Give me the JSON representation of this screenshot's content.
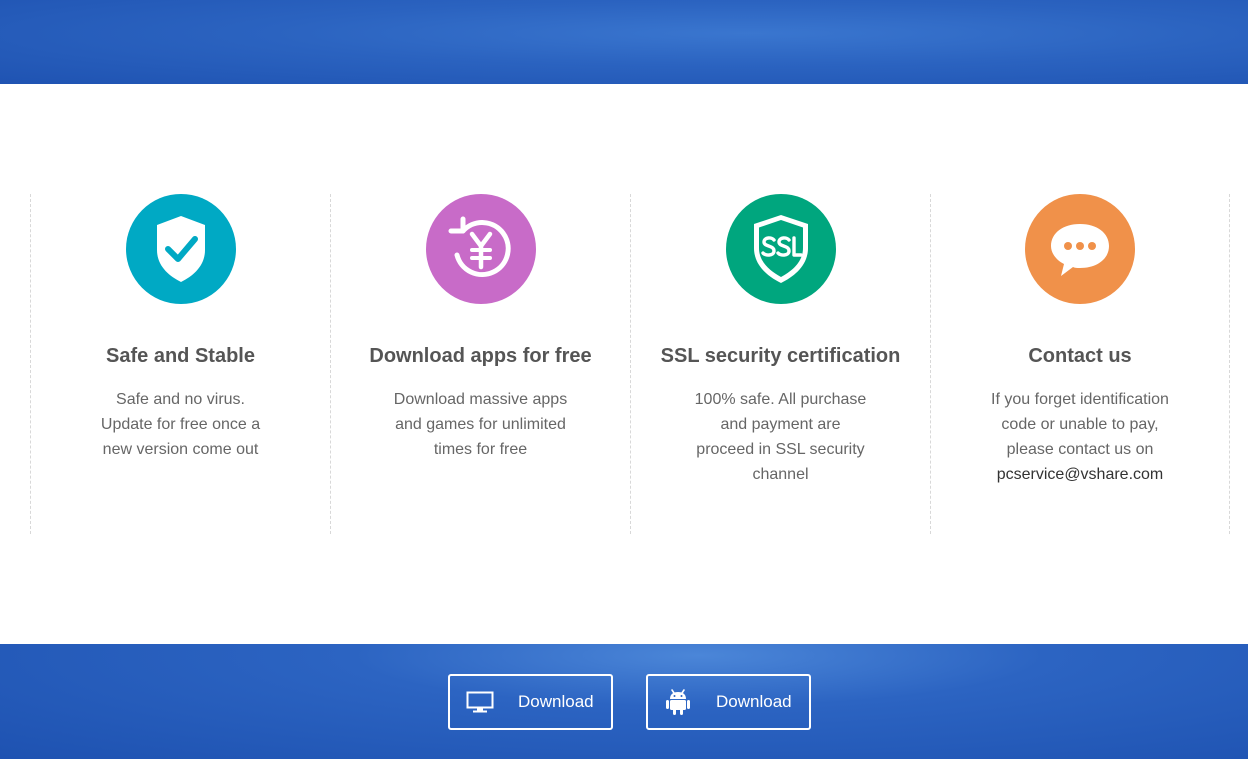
{
  "features": [
    {
      "title": "Safe and Stable",
      "desc": [
        "Safe and no virus.",
        "Update for free once a",
        "new version come out"
      ],
      "icon": "shield-check-icon",
      "color": "#00a9c4"
    },
    {
      "title": "Download apps for free",
      "desc": [
        "Download massive apps",
        "and games for unlimited",
        "times for free"
      ],
      "icon": "yen-refresh-icon",
      "color": "#c86bc8"
    },
    {
      "title": "SSL security certification",
      "desc": [
        "100% safe. All purchase",
        "and payment are",
        "proceed in SSL security",
        "channel"
      ],
      "icon": "ssl-shield-icon",
      "color": "#00a67e"
    },
    {
      "title": "Contact us",
      "desc": [
        "If you forget identification",
        "code or unable to pay,",
        "please contact us on"
      ],
      "email": "pcservice@vshare.com",
      "icon": "chat-bubble-icon",
      "color": "#f0914a"
    }
  ],
  "download": {
    "pc_label": "Download",
    "pc_icon": "monitor-icon",
    "android_label": "Download",
    "android_icon": "android-icon"
  }
}
